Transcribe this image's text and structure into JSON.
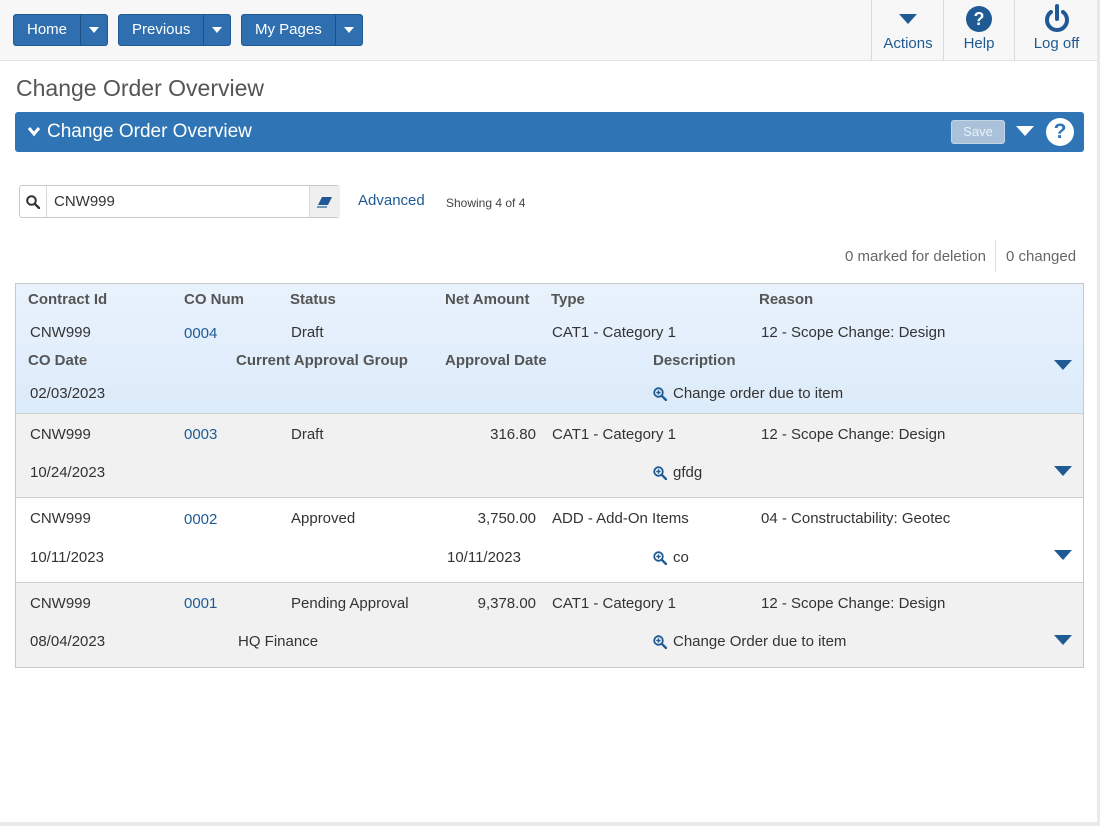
{
  "nav": {
    "home": "Home",
    "previous": "Previous",
    "my_pages": "My Pages"
  },
  "toolbar": {
    "actions": "Actions",
    "help": "Help",
    "logoff": "Log off"
  },
  "page": {
    "title": "Change Order Overview"
  },
  "panel": {
    "title": "Change Order Overview",
    "save": "Save"
  },
  "search": {
    "value": "CNW999",
    "advanced": "Advanced",
    "showing": "Showing 4 of 4"
  },
  "status": {
    "marked": "0 marked for deletion",
    "changed": "0 changed"
  },
  "columns": {
    "contract_id": "Contract Id",
    "co_num": "CO Num",
    "status": "Status",
    "net_amount": "Net Amount",
    "type": "Type",
    "reason": "Reason",
    "co_date": "CO Date",
    "approval_group": "Current Approval Group",
    "approval_date": "Approval Date",
    "description": "Description"
  },
  "rows": [
    {
      "contract_id": "CNW999",
      "co_num": "0004",
      "status": "Draft",
      "net_amount": "",
      "type": "CAT1 - Category 1",
      "reason": "12 - Scope Change: Design",
      "co_date": "02/03/2023",
      "approval_group": "",
      "approval_date": "",
      "description": "Change order due to item"
    },
    {
      "contract_id": "CNW999",
      "co_num": "0003",
      "status": "Draft",
      "net_amount": "316.80",
      "type": "CAT1 - Category 1",
      "reason": "12 - Scope Change: Design",
      "co_date": "10/24/2023",
      "approval_group": "",
      "approval_date": "",
      "description": "gfdg"
    },
    {
      "contract_id": "CNW999",
      "co_num": "0002",
      "status": "Approved",
      "net_amount": "3,750.00",
      "type": "ADD - Add-On Items",
      "reason": "04 - Constructability: Geotec",
      "co_date": "10/11/2023",
      "approval_group": "",
      "approval_date": "10/11/2023",
      "description": "co"
    },
    {
      "contract_id": "CNW999",
      "co_num": "0001",
      "status": "Pending Approval",
      "net_amount": "9,378.00",
      "type": "CAT1 - Category 1",
      "reason": "12 - Scope Change: Design",
      "co_date": "08/04/2023",
      "approval_group": "HQ Finance",
      "approval_date": "",
      "description": "Change Order due to item"
    }
  ]
}
